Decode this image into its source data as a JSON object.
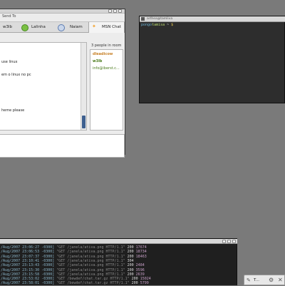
{
  "chat": {
    "menu_send_to": "Send To",
    "tabs": [
      {
        "label": "w3lb"
      },
      {
        "label": "Lalinha"
      },
      {
        "label": "Naiam"
      },
      {
        "label": "MSN Chat"
      }
    ],
    "messages": [
      "use linux",
      "em o linux no pc",
      "heme please"
    ],
    "people_header": "3 people in room",
    "people": [
      {
        "name": "dleadicow",
        "color": "#c8822a"
      },
      {
        "name": "w3lb",
        "color": "#4a7a1a"
      },
      {
        "name": "info@iberst.c...",
        "color": "#4a7a1a"
      }
    ]
  },
  "term_small": {
    "title": "arthea@tamliva",
    "prompt_user": "pongo",
    "prompt_host": "tamisa",
    "prompt_path": "~",
    "prompt_cursor": "$"
  },
  "term_log": {
    "lines": [
      {
        "date": "/Aug/2007 23:06:27 -0300]",
        "req": "\"GET /janela/ativa.png HTTP/1.1\"",
        "status": "200",
        "size": "17674"
      },
      {
        "date": "/Aug/2007 23:06:53 -0300]",
        "req": "\"GET /janela/ativa.png HTTP/1.1\"",
        "status": "200",
        "size": "18734"
      },
      {
        "date": "/Aug/2007 23:07:37 -0300]",
        "req": "\"GET /janela/ativa.png HTTP/1.1\"",
        "status": "200",
        "size": "18463"
      },
      {
        "date": "/Aug/2007 23:10:41 -0300]",
        "req": "\"GET /janela/ativa.png HTTP/1.1\"",
        "status": "304",
        "size": ""
      },
      {
        "date": "/Aug/2007 23:13:43 -0300]",
        "req": "\"GET /janela/ativa.png HTTP/1.1\"",
        "status": "200",
        "size": "2484"
      },
      {
        "date": "/Aug/2007 23:15:30 -0300]",
        "req": "\"GET /janela/ativa.png HTTP/1.1\"",
        "status": "200",
        "size": "3596"
      },
      {
        "date": "/Aug/2007 23:15:58 -0300]",
        "req": "\"GET /janela/ativa.png HTTP/1.1\"",
        "status": "200",
        "size": "2639"
      },
      {
        "date": "/Aug/2007 23:53:02 -0300]",
        "req": "\"GET /bewdef/chat.tar.gz HTTP/1.1\"",
        "status": "200",
        "size": "15024"
      },
      {
        "date": "/Aug/2007 23:58:01 -0300]",
        "req": "\"GET /bewdef/chat.tar.gz HTTP/1.1\"",
        "status": "200",
        "size": "5799"
      }
    ]
  },
  "tray": {
    "label": "T..."
  }
}
